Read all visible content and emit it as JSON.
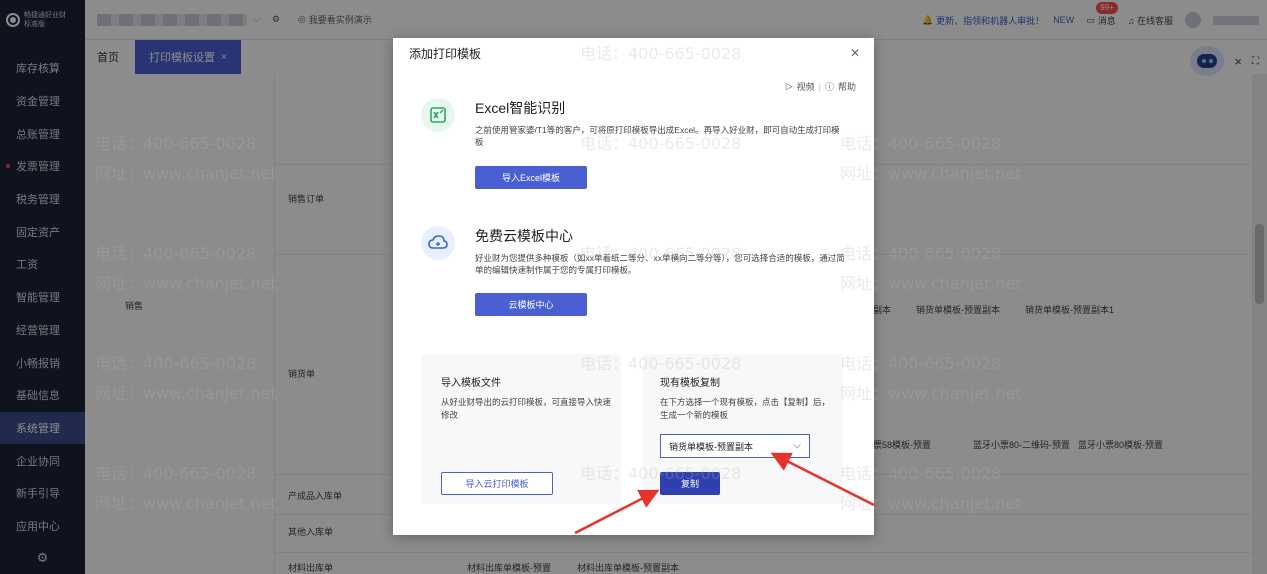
{
  "app": {
    "brand_line1": "畅捷通好业财",
    "brand_line2": "标准版"
  },
  "sidebar": {
    "items": [
      {
        "label": "库存核算"
      },
      {
        "label": "资金管理"
      },
      {
        "label": "总账管理"
      },
      {
        "label": "发票管理"
      },
      {
        "label": "税务管理"
      },
      {
        "label": "固定资产"
      },
      {
        "label": "工资"
      },
      {
        "label": "智能管理"
      },
      {
        "label": "经营管理"
      },
      {
        "label": "小畅报销"
      },
      {
        "label": "基础信息"
      },
      {
        "label": "系统管理"
      },
      {
        "label": "企业协同"
      },
      {
        "label": "新手引导"
      },
      {
        "label": "应用中心"
      }
    ],
    "active_index": 11
  },
  "topbar": {
    "demo_label": "我要看实例演示",
    "upgrade_label": "更新、指领和机器人审批！",
    "new_label": "NEW",
    "msg_label": "消息",
    "msg_badge": "99+",
    "service_label": "在线客服"
  },
  "tabs": {
    "home": "首页",
    "active": "打印模板设置"
  },
  "background": {
    "group_label": "销售",
    "rows": [
      "销售订单",
      "销货单",
      "产成品入库单",
      "其他入库单",
      "材料出库单"
    ],
    "row_extras": {
      "xiao_huo_dan_templates": [
        "副本",
        "销货单模板-预置副本",
        "销货单模板-预置副本1"
      ],
      "xiao_piao_templates": [
        "票58模板-预置",
        "蓝牙小票80-二维码-预置",
        "蓝牙小票80模板-预置"
      ],
      "material_templates": [
        "材料出库单模板-预置",
        "材料出库单模板-预置副本"
      ]
    }
  },
  "modal": {
    "title": "添加打印模板",
    "video_label": "视频",
    "help_label": "帮助",
    "excel": {
      "title": "Excel智能识别",
      "desc": "之前使用管家婆/T1等的客户，可将原打印模板导出成Excel。再导入好业财，即可自动生成打印模板",
      "button": "导入Excel模板"
    },
    "cloud": {
      "title": "免费云模板中心",
      "desc": "好业财为您提供多种模板（如xx单着纸二等分、xx单横向二等分等），您可选择合适的模板，通过简单的编辑快速制作属于您的专属打印模板。",
      "button": "云模板中心"
    },
    "import_file": {
      "title": "导入模板文件",
      "desc": "从好业财导出的云打印模板，可直接导入快速修改",
      "button": "导入云打印模板"
    },
    "copy": {
      "title": "现有模板复制",
      "desc": "在下方选择一个现有模板，点击【复制】后，生成一个新的模板",
      "select_value": "销货单模板-预置副本",
      "button": "复制"
    }
  },
  "watermark": {
    "phone": "电话：400-665-0028",
    "site": "网址：www.chanjet.net"
  },
  "colors": {
    "sidebar_bg": "#1e2235",
    "primary": "#4a5fd1",
    "active_nav": "#3d4d8c",
    "arrow": "#e8312b"
  }
}
